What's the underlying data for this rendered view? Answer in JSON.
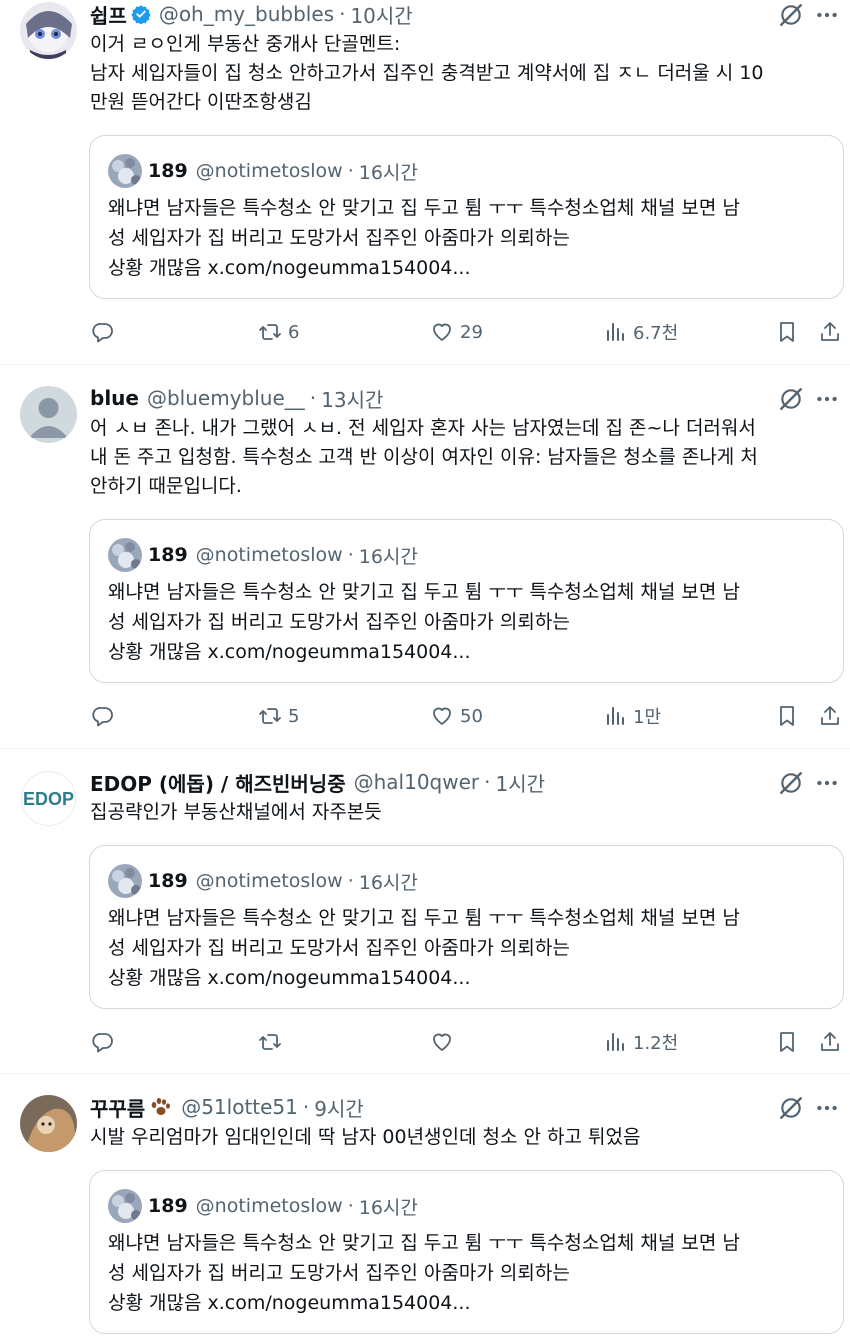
{
  "tweets": [
    {
      "name": "쉽프",
      "handle": "@oh_my_bubbles",
      "dot": "·",
      "time": "10시간",
      "text_lines": [
        "이거 ㄹㅇ인게 부동산 중개사 단골멘트:",
        "남자 세입자들이 집 청소 안하고가서 집주인 충격받고 계약서에 집 ㅈㄴ 더러울 시 10",
        "만원 뜯어간다 이딴조항생김"
      ],
      "stats": {
        "reply": "",
        "retweet": "6",
        "like": "29",
        "views": "6.7천"
      }
    },
    {
      "name": "blue",
      "handle": "@bluemyblue__",
      "dot": "·",
      "time": "13시간",
      "text_lines": [
        "어 ㅅㅂ 존나. 내가 그랬어 ㅅㅂ. 전 세입자 혼자 사는 남자였는데 집 존~나 더러워서",
        "내 돈 주고 입청함. 특수청소 고객 반 이상이 여자인 이유: 남자들은 청소를 존나게 처",
        "안하기 때문입니다."
      ],
      "stats": {
        "reply": "",
        "retweet": "5",
        "like": "50",
        "views": "1만"
      }
    },
    {
      "name": "EDOP (에돕) / 해즈빈버닝중",
      "handle": "@hal10qwer",
      "dot": "·",
      "time": "1시간",
      "text_lines": [
        "집공략인가 부동산채널에서 자주본듯"
      ],
      "stats": {
        "reply": "",
        "retweet": "",
        "like": "",
        "views": "1.2천"
      }
    },
    {
      "name": "꾸꾸름",
      "handle": "@51lotte51",
      "dot": "·",
      "time": "9시간",
      "text_lines": [
        "시발 우리엄마가 임대인인데 딱 남자 00년생인데 청소 안 하고 튀었음"
      ],
      "stats": {
        "reply": "",
        "retweet": "",
        "like": "",
        "views": ""
      }
    }
  ],
  "quote": {
    "name": "189",
    "handle": "@notimetoslow",
    "dot": "·",
    "time": "16시간",
    "text_lines": [
      "왜냐면 남자들은 특수청소 안 맞기고 집 두고 튐 ㅜㅜ 특수청소업체 채널 보면 남",
      "성 세입자가 집 버리고 도망가서 집주인 아줌마가 의뢰하는",
      "상황 개많음 x.com/nogeumma154004..."
    ]
  },
  "icons": {
    "verified": "verified-badge-icon",
    "grok": "grok-icon",
    "more": "more-icon",
    "reply": "reply-icon",
    "retweet": "retweet-icon",
    "like": "heart-icon",
    "views": "views-icon",
    "bookmark": "bookmark-icon",
    "share": "share-icon",
    "paw": "paw-icon"
  },
  "colors": {
    "verified": "#1d9bf0",
    "secondary_text": "#536471",
    "border": "#cfd9de"
  }
}
